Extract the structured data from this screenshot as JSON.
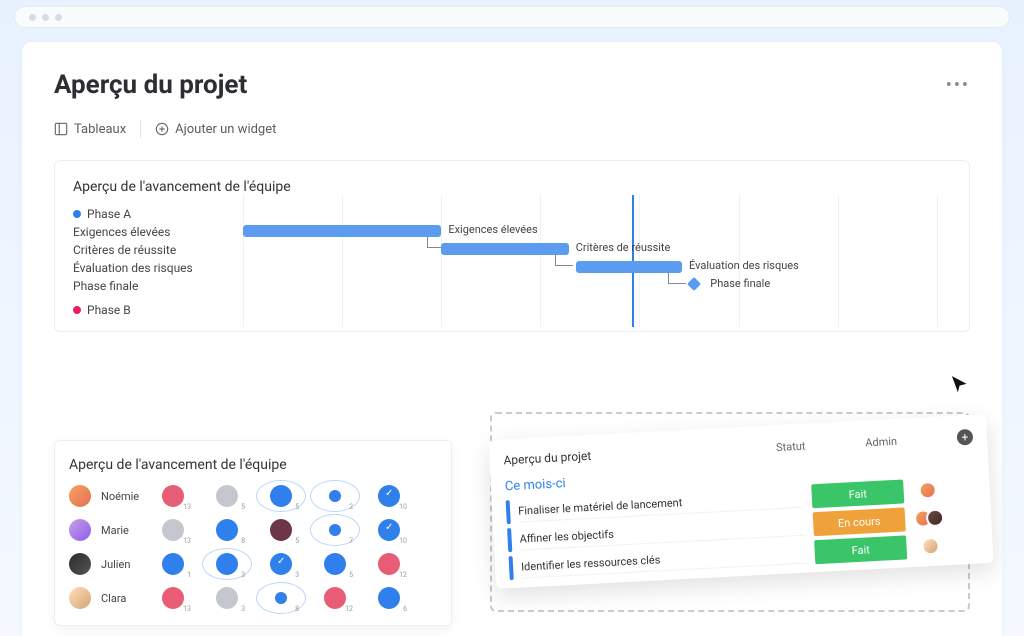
{
  "header": {
    "title": "Aperçu du projet",
    "more_label": "•••"
  },
  "toolbar": {
    "boards_label": "Tableaux",
    "add_widget_label": "Ajouter un widget"
  },
  "gantt": {
    "title": "Aperçu de l'avancement de l'équipe",
    "phase_a_label": "Phase A",
    "phase_b_label": "Phase B",
    "rows": {
      "exigences": "Exigences élevées",
      "criteres": "Critères de réussite",
      "evaluation": "Évaluation des risques",
      "finale": "Phase finale"
    },
    "bar_labels": {
      "exigences": "Exigences élevées",
      "criteres": "Critères de réussite",
      "evaluation": "Évaluation des risques",
      "finale": "Phase finale"
    }
  },
  "team_card": {
    "title": "Aperçu de l'avancement de l'équipe",
    "members": {
      "noemie": "Noémie",
      "marie": "Marie",
      "julien": "Julien",
      "clara": "Clara"
    },
    "grid": {
      "noemie": [
        {
          "color": "c-pink",
          "num": "13"
        },
        {
          "color": "c-grey",
          "num": "5"
        },
        {
          "color": "c-blue",
          "num": "5",
          "ring": true
        },
        {
          "color": "c-blue-sm",
          "num": "2",
          "ring": true
        },
        {
          "color": "c-blue",
          "num": "10",
          "check": true
        }
      ],
      "marie": [
        {
          "color": "c-grey",
          "num": "13"
        },
        {
          "color": "c-blue",
          "num": "8"
        },
        {
          "color": "c-dark",
          "num": "5"
        },
        {
          "color": "c-blue-sm",
          "num": "7",
          "ring": true
        },
        {
          "color": "c-blue",
          "num": "10",
          "check": true
        }
      ],
      "julien": [
        {
          "color": "c-blue",
          "num": "1"
        },
        {
          "color": "c-blue",
          "num": "3",
          "ring": true
        },
        {
          "color": "c-blue",
          "num": "3",
          "check": true
        },
        {
          "color": "c-blue",
          "num": "5"
        },
        {
          "color": "c-pink",
          "num": "12"
        }
      ],
      "clara": [
        {
          "color": "c-pink",
          "num": "13"
        },
        {
          "color": "c-grey",
          "num": "3"
        },
        {
          "color": "c-blue-sm",
          "num": "8",
          "ring": true
        },
        {
          "color": "c-pink",
          "num": "12"
        },
        {
          "color": "c-blue",
          "num": "6"
        }
      ]
    }
  },
  "status_card": {
    "title": "Aperçu du projet",
    "col_status": "Statut",
    "col_admin": "Admin",
    "month": "Ce mois-ci",
    "tasks": {
      "t1": {
        "name": "Finaliser le matériel de lancement",
        "status": "Fait",
        "badge": "b-green"
      },
      "t2": {
        "name": "Affiner les objectifs",
        "status": "En cours",
        "badge": "b-orange"
      },
      "t3": {
        "name": "Identifier les ressources clés",
        "status": "Fait",
        "badge": "b-green"
      }
    }
  },
  "chart_data": {
    "type": "gantt",
    "title": "Aperçu de l'avancement de l'équipe",
    "today_marker": 55,
    "tasks": [
      {
        "name": "Exigences élevées",
        "start": 0,
        "end": 28,
        "phase": "A"
      },
      {
        "name": "Critères de réussite",
        "start": 28,
        "end": 46,
        "phase": "A"
      },
      {
        "name": "Évaluation des risques",
        "start": 47,
        "end": 62,
        "phase": "A"
      },
      {
        "name": "Phase finale",
        "start": 64,
        "end": 64,
        "milestone": true,
        "phase": "A"
      }
    ]
  }
}
